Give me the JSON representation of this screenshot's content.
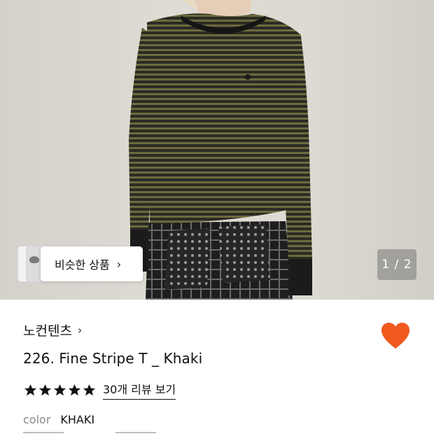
{
  "gallery": {
    "similar_label": "비슷한 상품",
    "similar_chevron": "›",
    "pager": "1 / 2",
    "current_page": 1,
    "total_pages": 2
  },
  "product": {
    "brand": "노컨텐츠",
    "brand_chevron": "›",
    "title": "226. Fine Stripe T _ Khaki",
    "rating_stars": 5,
    "reviews_link": "30개 리뷰 보기",
    "color_label": "color",
    "color_value": "KHAKI",
    "liked": true
  },
  "colors": {
    "heart": "#f05a1e",
    "stripe_dark": "#2c2e28",
    "stripe_khaki": "#6d6a3d"
  },
  "icons": {
    "like": "heart-icon",
    "star": "star-icon",
    "chevron": "chevron-right-icon"
  }
}
